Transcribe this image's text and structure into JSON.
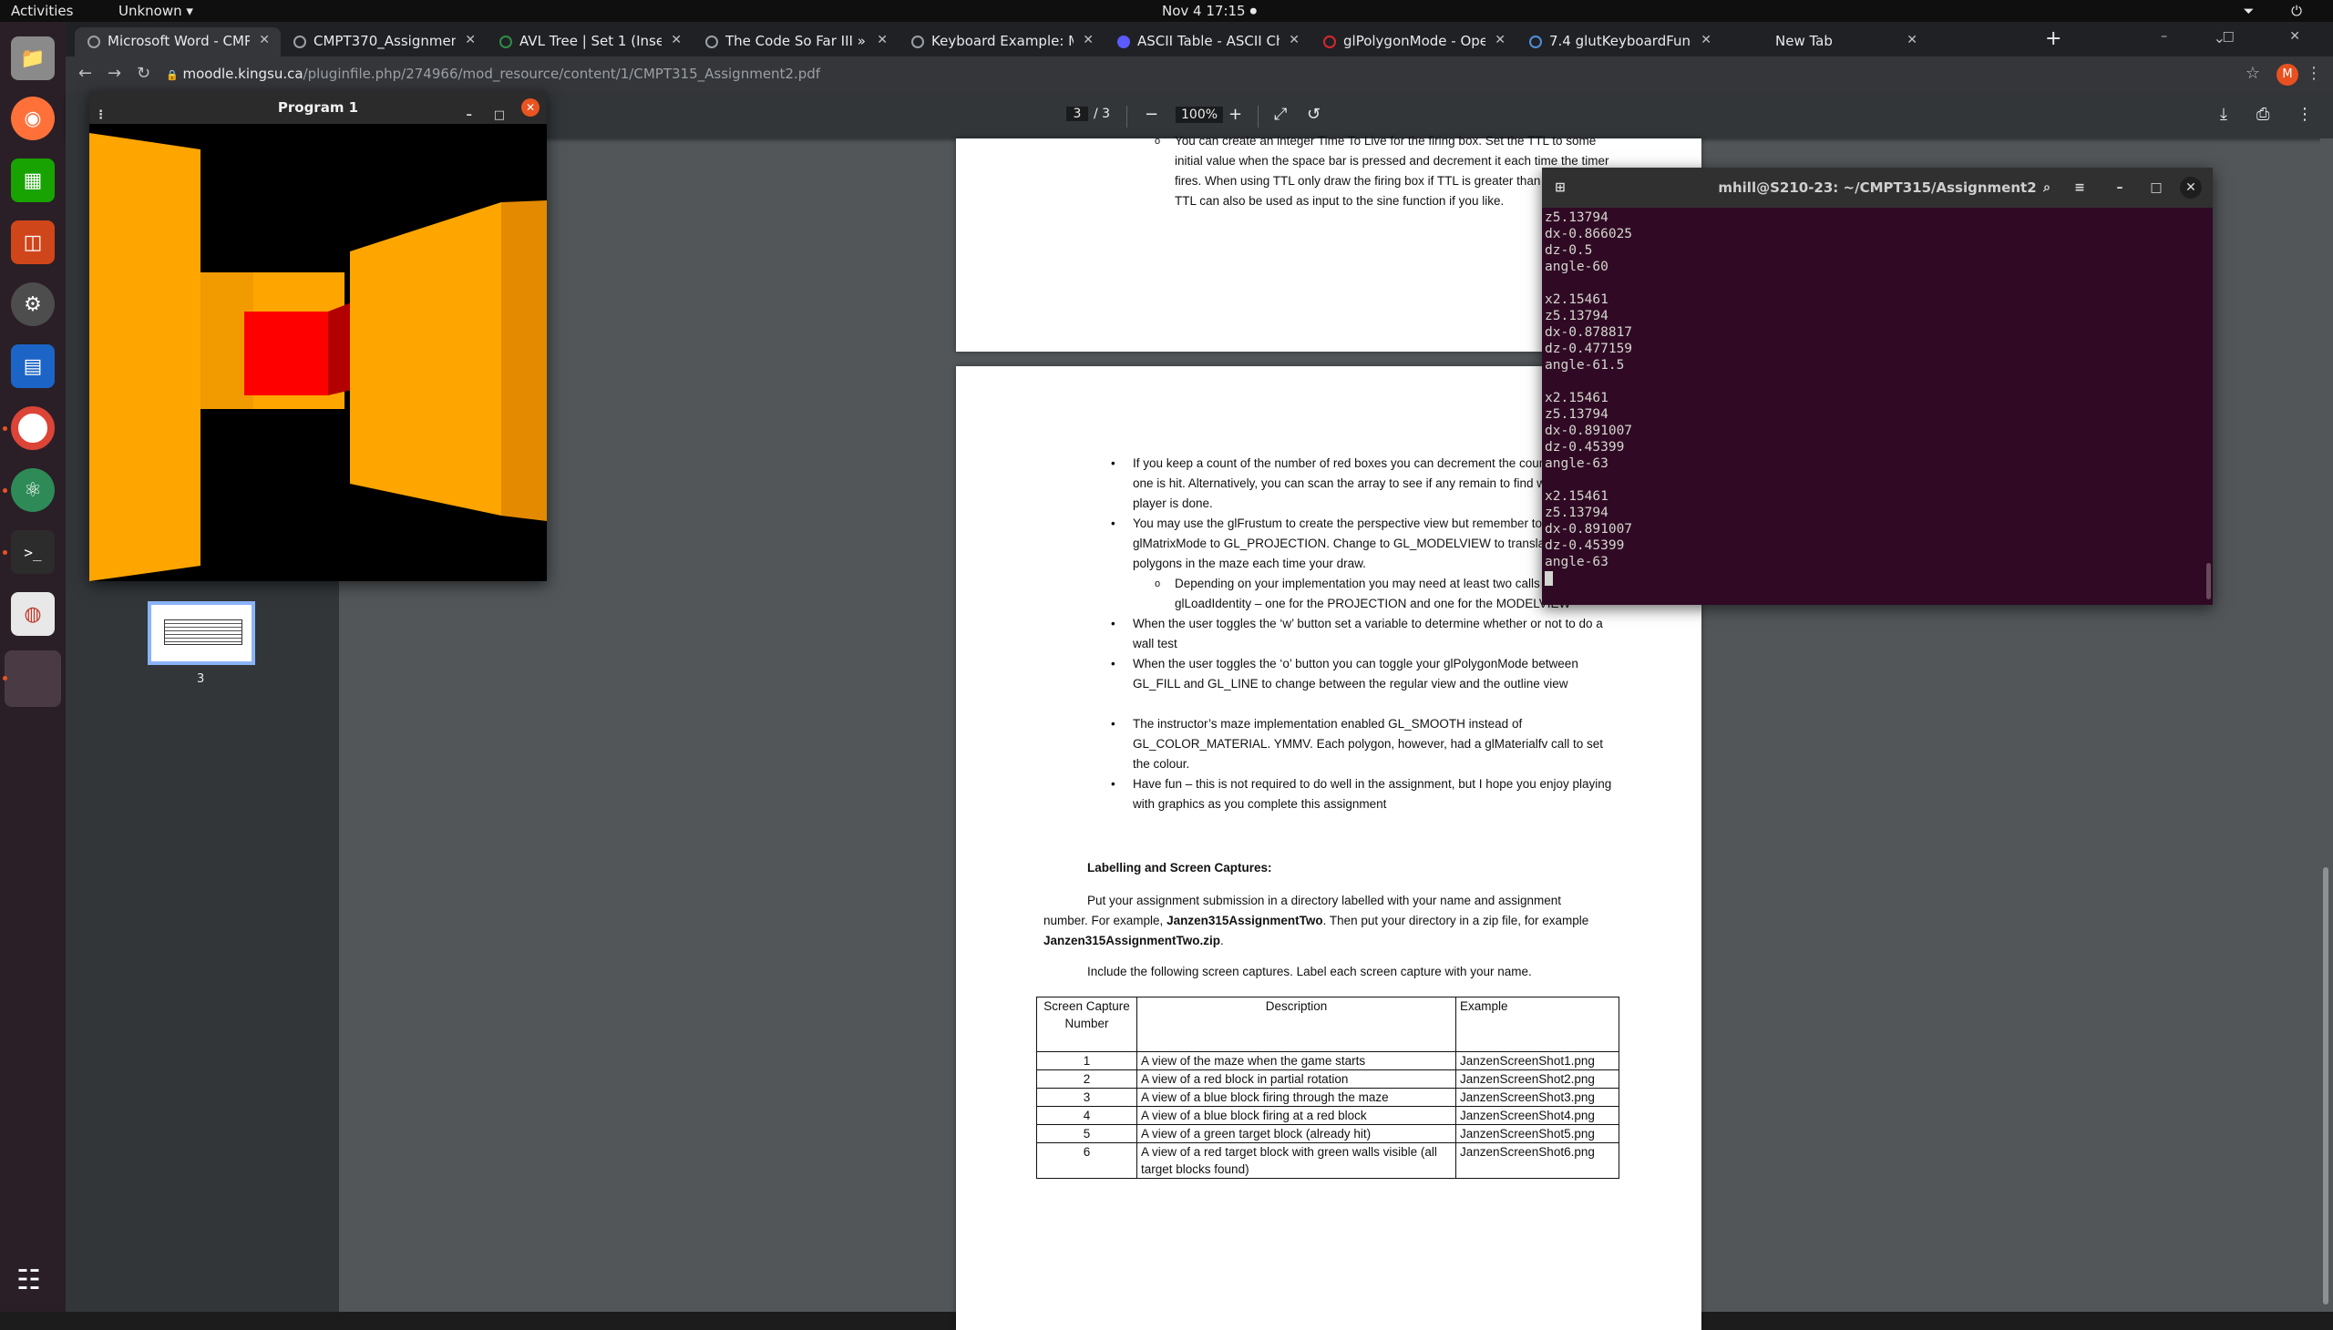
{
  "topbar": {
    "activities": "Activities",
    "app_menu": "Unknown ▾",
    "clock": "Nov 4  17:15",
    "clock_dot": "●",
    "tray": "⏷ ⏻"
  },
  "dock": {
    "items": [
      "files-icon",
      "firefox-icon",
      "calc-icon",
      "impress-icon",
      "settings-icon",
      "writer-icon",
      "chrome-icon",
      "atom-icon",
      "terminal-icon",
      "document-viewer-icon",
      "active-app-icon"
    ],
    "apps_grid": "☷"
  },
  "browser": {
    "tabs": [
      {
        "label": "Microsoft Word - CMPT3…",
        "active": true
      },
      {
        "label": "CMPT370_AssignmentTw…"
      },
      {
        "label": "AVL Tree | Set 1 (Insertion…"
      },
      {
        "label": "The Code So Far III » Light…"
      },
      {
        "label": "Keyboard Example: Movin…"
      },
      {
        "label": "ASCII Table - ASCII Charac…"
      },
      {
        "label": "glPolygonMode - OpenGL…"
      },
      {
        "label": "7.4 glutKeyboardFunc"
      },
      {
        "label": "New Tab"
      }
    ],
    "new_tab": "+",
    "tab_close": "✕",
    "tab_search": "⌄",
    "window_controls": "– □ ✕",
    "nav": {
      "back": "←",
      "forward": "→",
      "reload": "↻",
      "lock": "🔒"
    },
    "url_host": "moodle.kingsu.ca",
    "url_path": "/pluginfile.php/274966/mod_resource/content/1/CMPT315_Assignment2.pdf",
    "star": "☆",
    "profile": "M",
    "menu": "⋮"
  },
  "pdf": {
    "page_current": "3",
    "page_sep": "/",
    "page_total": "3",
    "zoom_out": "−",
    "zoom": "100%",
    "zoom_in": "+",
    "fit": "⤢",
    "rotate": "↺",
    "download": "⤓",
    "print": "⎙",
    "more": "⋮",
    "thumb_page": "3",
    "page2": {
      "sub1": "You can create an integer Time To Live for the firing box.  Set the TTL to some initial value when the space bar is pressed and decrement it each time the timer fires.  When using TTL only draw the firing box if TTL is greater than zero.  The TTL can also be used as input to the sine function if you like."
    },
    "page3": {
      "b1": "If you keep a count of the number of red boxes you can decrement the count each time one is hit.  Alternatively, you can scan the array to see if any remain to find when the player is done.",
      "b2": "You may use the glFrustum to create the perspective view but remember to set the glMatrixMode to GL_PROJECTION.  Change to GL_MODELVIEW to translate or rotate polygons in the maze each time your draw.",
      "sub2": "Depending on your implementation you may need at least two calls to glLoadIdentity – one for the PROJECTION and one for the MODELVIEW",
      "b3": "When the user toggles the ‘w’ button set a variable to determine whether or not to do a wall test",
      "b4": "When the user toggles the ‘o’ button you can toggle your glPolygonMode between GL_FILL and GL_LINE to change between the regular view and the outline view",
      "b5": "The instructor’s maze implementation enabled  GL_SMOOTH instead of GL_COLOR_MATERIAL. YMMV.  Each polygon, however, had a glMaterialfv call to set the colour.",
      "b6": "Have fun – this is not required to do well in the assignment, but I hope you enjoy playing with graphics as you complete this assignment",
      "heading": "Labelling and Screen Captures:",
      "p1_a": "Put your assignment submission in a directory labelled with your name and assignment number.  For example, ",
      "p1_b": "Janzen315AssignmentTwo",
      "p1_c": ".  Then put your directory in a zip file, for example ",
      "p1_d": "Janzen315AssignmentTwo.zip",
      "p1_e": ".",
      "p2": "Include the following screen captures.  Label each screen capture with your name.",
      "table": {
        "h_num": "Screen Capture Number",
        "h_desc": "Description",
        "h_ex": "Example",
        "rows": [
          {
            "num": "1",
            "desc": "A view of the maze when the game starts",
            "ex": "JanzenScreenShot1.png"
          },
          {
            "num": "2",
            "desc": "A view of a red block in partial rotation",
            "ex": "JanzenScreenShot2.png"
          },
          {
            "num": "3",
            "desc": "A view of a blue block firing through the maze",
            "ex": "JanzenScreenShot3.png"
          },
          {
            "num": "4",
            "desc": "A view of a blue block firing at a red block",
            "ex": "JanzenScreenShot4.png"
          },
          {
            "num": "5",
            "desc": "A view of a green target block (already hit)",
            "ex": "JanzenScreenShot5.png"
          },
          {
            "num": "6",
            "desc": "A view of a red target block with green walls visible (all target blocks found)",
            "ex": "JanzenScreenShot6.png"
          }
        ]
      }
    }
  },
  "program_window": {
    "title": "Program 1",
    "menu": "⋮",
    "minimize": "–",
    "maximize": "□",
    "close": "✕"
  },
  "terminal": {
    "title": "mhill@S210-23: ~/CMPT315/Assignment2",
    "output": "z5.13794\ndx-0.866025\ndz-0.5\nangle-60\n\nx2.15461\nz5.13794\ndx-0.878817\ndz-0.477159\nangle-61.5\n\nx2.15461\nz5.13794\ndx-0.891007\ndz-0.45399\nangle-63\n\nx2.15461\nz5.13794\ndx-0.891007\ndz-0.45399\nangle-63\n",
    "new_tab_icon": "⊞",
    "search": "⌕",
    "menu": "≡",
    "minimize": "–",
    "maximize": "□",
    "close": "✕"
  },
  "colors": {
    "ubuntu_orange": "#e95420",
    "maze_wall": "#ffa500",
    "target_block": "#ff0000",
    "terminal_bg": "#300a24"
  }
}
